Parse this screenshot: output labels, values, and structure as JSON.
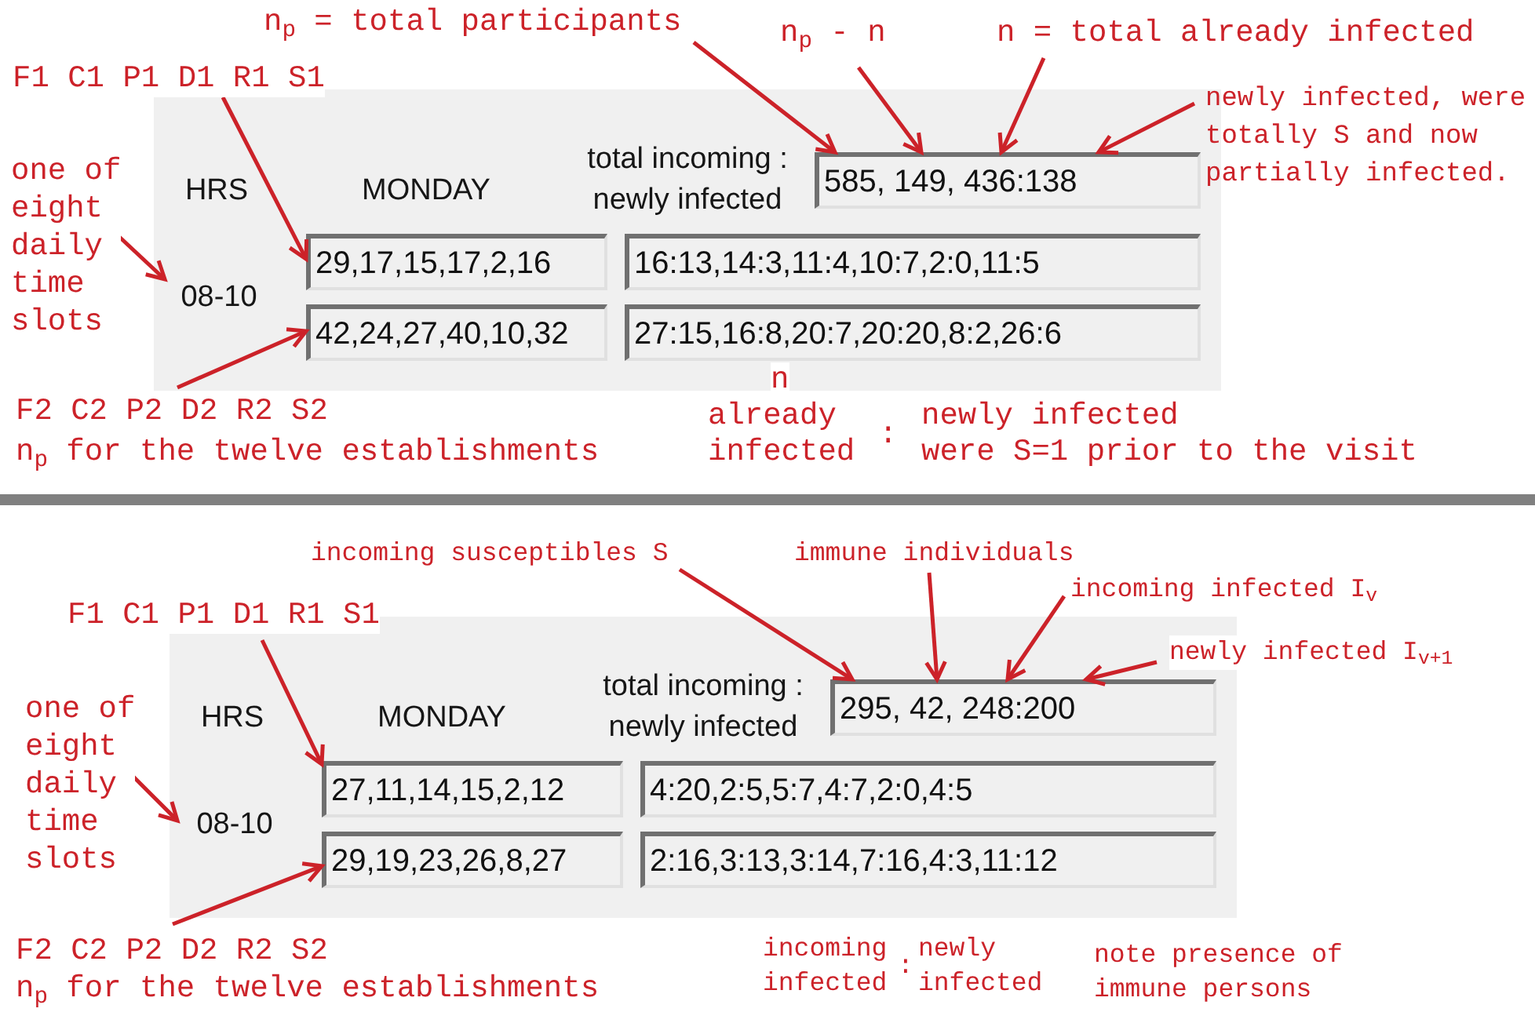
{
  "figures": [
    {
      "callouts_top": [
        {
          "lines": [
            "n$_{p}$ = total participants"
          ]
        },
        {
          "lines": [
            "n$_{p}$ - n"
          ]
        },
        {
          "lines": [
            "n = total already infected"
          ]
        },
        {
          "lines": [
            "F1 C1 P1 D1 R1 S1"
          ]
        },
        {
          "lines": [
            "newly infected, were",
            "totally S and now",
            "partially infected."
          ]
        },
        {
          "lines": [
            "one of",
            "eight",
            "daily",
            "time",
            "slots"
          ]
        }
      ],
      "panel": {
        "hours_header": "HRS",
        "day_header": "MONDAY",
        "total_label": [
          "total incoming :",
          "newly infected"
        ],
        "total_value": "585, 149, 436:138",
        "time_slot": "08-10",
        "rows": [
          {
            "participants": "29,17,15,17,2,16",
            "infections": "16:13,14:3,11:4,10:7,2:0,11:5"
          },
          {
            "participants": "42,24,27,40,10,32",
            "infections": "27:15,16:8,20:7,20:20,8:2,26:6"
          }
        ]
      },
      "callouts_left": [
        {
          "lines": [
            "F2 C2 P2 D2 R2 S2"
          ]
        },
        {
          "lines": [
            "n$_{p}$ for the twelve establishments"
          ]
        }
      ],
      "callouts_bottom": [
        {
          "lines": [
            "n"
          ]
        },
        {
          "lines": [
            "already",
            "infected"
          ]
        },
        {
          "lines": [
            ":"
          ]
        },
        {
          "lines": [
            "newly infected",
            "were S=1 prior to the visit"
          ]
        }
      ]
    },
    {
      "callouts_top": [
        {
          "lines": [
            "incoming susceptibles S"
          ]
        },
        {
          "lines": [
            "immune individuals"
          ]
        },
        {
          "lines": [
            "incoming infected I$_{v}$"
          ]
        },
        {
          "lines": [
            "F1 C1 P1 D1 R1 S1"
          ]
        },
        {
          "lines": [
            "newly infected I$_{v+1}$"
          ]
        },
        {
          "lines": [
            "one of",
            "eight",
            "daily",
            "time",
            "slots"
          ]
        }
      ],
      "panel": {
        "hours_header": "HRS",
        "day_header": "MONDAY",
        "total_label": [
          "total incoming :",
          "newly infected"
        ],
        "total_value": "295, 42, 248:200",
        "time_slot": "08-10",
        "rows": [
          {
            "participants": "27,11,14,15,2,12",
            "infections": "4:20,2:5,5:7,4:7,2:0,4:5"
          },
          {
            "participants": "29,19,23,26,8,27",
            "infections": "2:16,3:13,3:14,7:16,4:3,11:12"
          }
        ]
      },
      "callouts_left": [
        {
          "lines": [
            "F2 C2 P2 D2 R2 S2"
          ]
        },
        {
          "lines": [
            "n$_{p}$ for the twelve establishments"
          ]
        }
      ],
      "callouts_bottom": [
        {
          "lines": [
            "incoming",
            "infected"
          ]
        },
        {
          "lines": [
            ":"
          ]
        },
        {
          "lines": [
            "newly",
            "infected"
          ]
        },
        {
          "lines": [
            "note presence of",
            "immune persons"
          ]
        }
      ]
    }
  ]
}
